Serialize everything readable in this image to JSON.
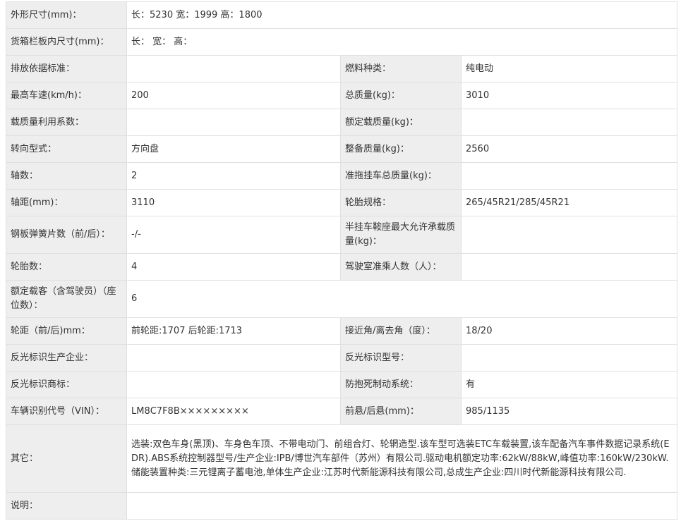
{
  "rows": [
    {
      "cells": [
        {
          "label": "外形尺寸(mm)：",
          "value": "长：5230 宽：1999 高：1800",
          "span": true
        }
      ]
    },
    {
      "cells": [
        {
          "label": "货箱栏板内尺寸(mm)：",
          "value": "长： 宽： 高：",
          "span": true
        }
      ]
    },
    {
      "cells": [
        {
          "label": "排放依据标准：",
          "value": ""
        },
        {
          "label": "燃料种类：",
          "value": "纯电动"
        }
      ]
    },
    {
      "cells": [
        {
          "label": "最高车速(km/h)：",
          "value": "200"
        },
        {
          "label": "总质量(kg)：",
          "value": "3010"
        }
      ]
    },
    {
      "cells": [
        {
          "label": "载质量利用系数：",
          "value": ""
        },
        {
          "label": "额定载质量(kg)：",
          "value": ""
        }
      ]
    },
    {
      "cells": [
        {
          "label": "转向型式：",
          "value": "方向盘"
        },
        {
          "label": "整备质量(kg)：",
          "value": "2560"
        }
      ]
    },
    {
      "cells": [
        {
          "label": "轴数：",
          "value": "2"
        },
        {
          "label": "准拖挂车总质量(kg)：",
          "value": ""
        }
      ]
    },
    {
      "cells": [
        {
          "label": "轴距(mm)：",
          "value": "3110"
        },
        {
          "label": "轮胎规格：",
          "value": "265/45R21/285/45R21"
        }
      ]
    },
    {
      "cells": [
        {
          "label": "钢板弹簧片数（前/后）：",
          "value": "-/-"
        },
        {
          "label": "半挂车鞍座最大允许承载质量(kg)：",
          "value": ""
        }
      ]
    },
    {
      "cells": [
        {
          "label": "轮胎数：",
          "value": "4"
        },
        {
          "label": "驾驶室准乘人数（人）：",
          "value": ""
        }
      ]
    },
    {
      "cells": [
        {
          "label": "额定载客（含驾驶员）（座位数）：",
          "value": "6",
          "span": true
        }
      ]
    },
    {
      "cells": [
        {
          "label": "轮距（前/后)mm：",
          "value": "前轮距:1707 后轮距:1713"
        },
        {
          "label": "接近角/离去角（度）：",
          "value": "18/20"
        }
      ]
    },
    {
      "cells": [
        {
          "label": "反光标识生产企业：",
          "value": ""
        },
        {
          "label": "反光标识型号：",
          "value": ""
        }
      ]
    },
    {
      "cells": [
        {
          "label": "反光标识商标：",
          "value": ""
        },
        {
          "label": "防抱死制动系统：",
          "value": "有"
        }
      ]
    },
    {
      "cells": [
        {
          "label": "车辆识别代号（VIN）：",
          "value": "LM8C7F8B×××××××××"
        },
        {
          "label": "前悬/后悬(mm)：",
          "value": "985/1135"
        }
      ]
    },
    {
      "cells": [
        {
          "label": "其它：",
          "value": "选装:双色车身(黑顶)、车身色车顶、不带电动门、前组合灯、轮辋造型.该车型可选装ETC车载装置,该车配备汽车事件数据记录系统(EDR).ABS系统控制器型号/生产企业:IPB/博世汽车部件（苏州）有限公司.驱动电机额定功率:62kW/88kW,峰值功率:160kW/230kW.储能装置种类:三元锂离子蓄电池,单体生产企业:江苏时代新能源科技有限公司,总成生产企业:四川时代新能源科技有限公司.",
          "span": true
        }
      ]
    },
    {
      "cells": [
        {
          "label": "说明：",
          "value": "",
          "span": true
        }
      ]
    }
  ]
}
